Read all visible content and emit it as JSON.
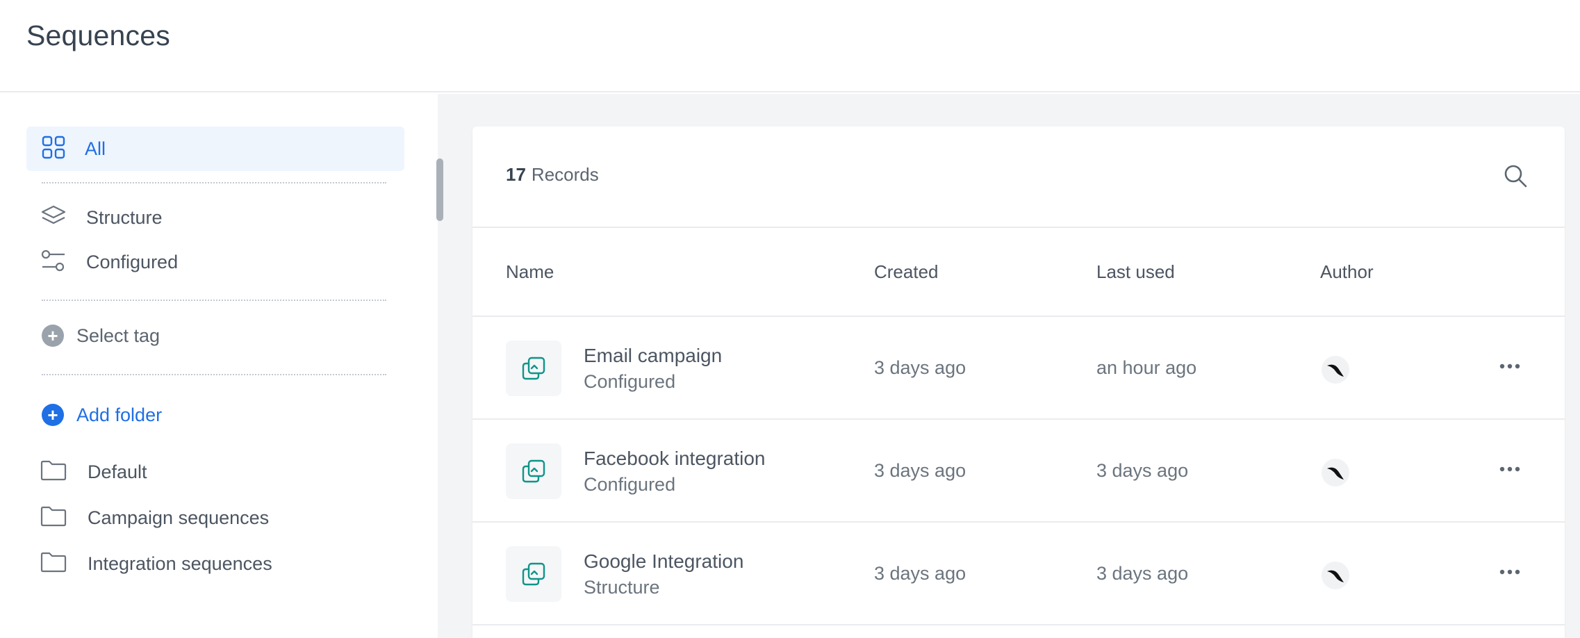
{
  "header": {
    "title": "Sequences"
  },
  "sidebar": {
    "filters": [
      {
        "label": "All",
        "icon": "grid-icon",
        "active": true
      },
      {
        "label": "Structure",
        "icon": "layers-icon"
      },
      {
        "label": "Configured",
        "icon": "sliders-icon"
      }
    ],
    "select_tag_label": "Select tag",
    "add_folder_label": "Add folder",
    "folders": [
      {
        "label": "Default"
      },
      {
        "label": "Campaign sequences"
      },
      {
        "label": "Integration sequences"
      }
    ]
  },
  "main": {
    "records_count": "17",
    "records_label": "Records",
    "columns": {
      "name": "Name",
      "created": "Created",
      "last_used": "Last used",
      "author": "Author"
    },
    "rows": [
      {
        "name": "Email campaign",
        "type": "Configured",
        "created": "3 days ago",
        "last_used": "an hour ago"
      },
      {
        "name": "Facebook integration",
        "type": "Configured",
        "created": "3 days ago",
        "last_used": "3 days ago"
      },
      {
        "name": "Google Integration",
        "type": "Structure",
        "created": "3 days ago",
        "last_used": "3 days ago"
      }
    ]
  },
  "colors": {
    "accent": "#1f6fe5",
    "active_bg": "#eff5fd",
    "row_icon": "#0f9488",
    "text": "#384350"
  }
}
